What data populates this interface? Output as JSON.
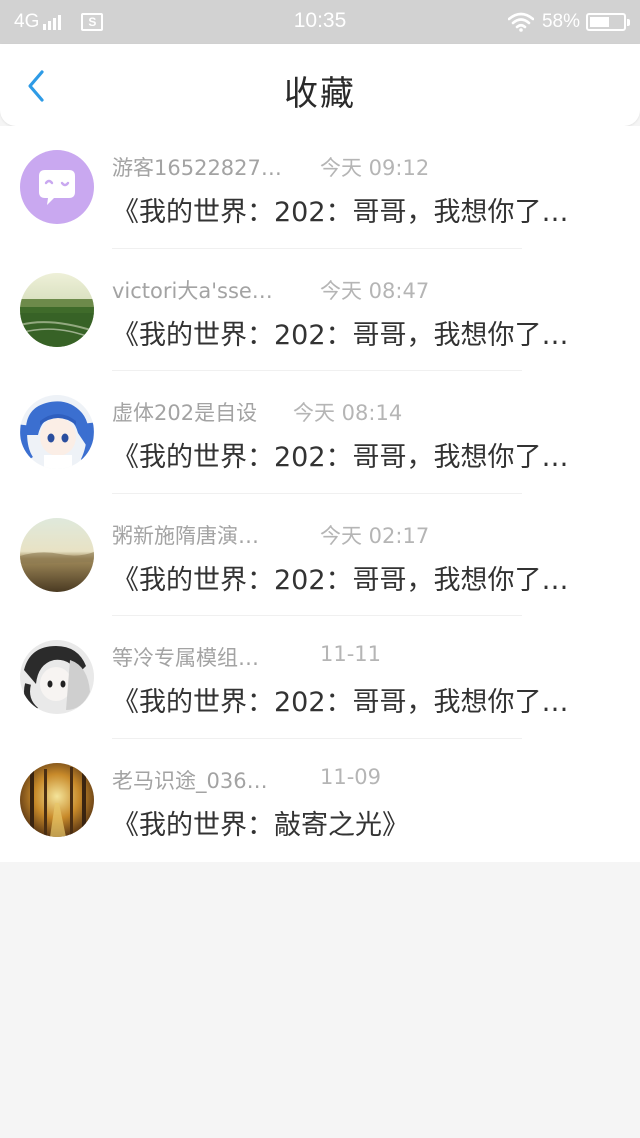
{
  "status_bar": {
    "network": "4G",
    "time": "10:35",
    "battery_text": "58%",
    "battery_level": 0.58,
    "icons": [
      "signal-icon",
      "sim-icon",
      "wifi-icon",
      "battery-icon"
    ]
  },
  "header": {
    "title": "收藏",
    "back_icon": "chevron-left-icon",
    "accent_color": "#2e9be6"
  },
  "favorites": [
    {
      "user": "游客16522827…",
      "time": "今天 09:12",
      "title": "《我的世界：202：哥哥，我想你了…",
      "avatar": "chat-bubble-avatar"
    },
    {
      "user": "victori大a'sse…",
      "time": "今天 08:47",
      "title": "《我的世界：202：哥哥，我想你了…",
      "avatar": "field-landscape-avatar"
    },
    {
      "user": "虚体202是自设",
      "time": "今天 08:14",
      "title": "《我的世界：202：哥哥，我想你了…",
      "avatar": "anime-blue-hair-avatar"
    },
    {
      "user": "粥新施隋唐演…",
      "time": "今天 02:17",
      "title": "《我的世界：202：哥哥，我想你了…",
      "avatar": "sunset-landscape-avatar"
    },
    {
      "user": "等冷专属模组…",
      "time": "11-11",
      "title": "《我的世界：202：哥哥，我想你了…",
      "avatar": "anime-mono-avatar"
    },
    {
      "user": "老马识途_036…",
      "time": "11-09",
      "title": "《我的世界：敲寄之光》",
      "avatar": "autumn-forest-avatar"
    }
  ]
}
